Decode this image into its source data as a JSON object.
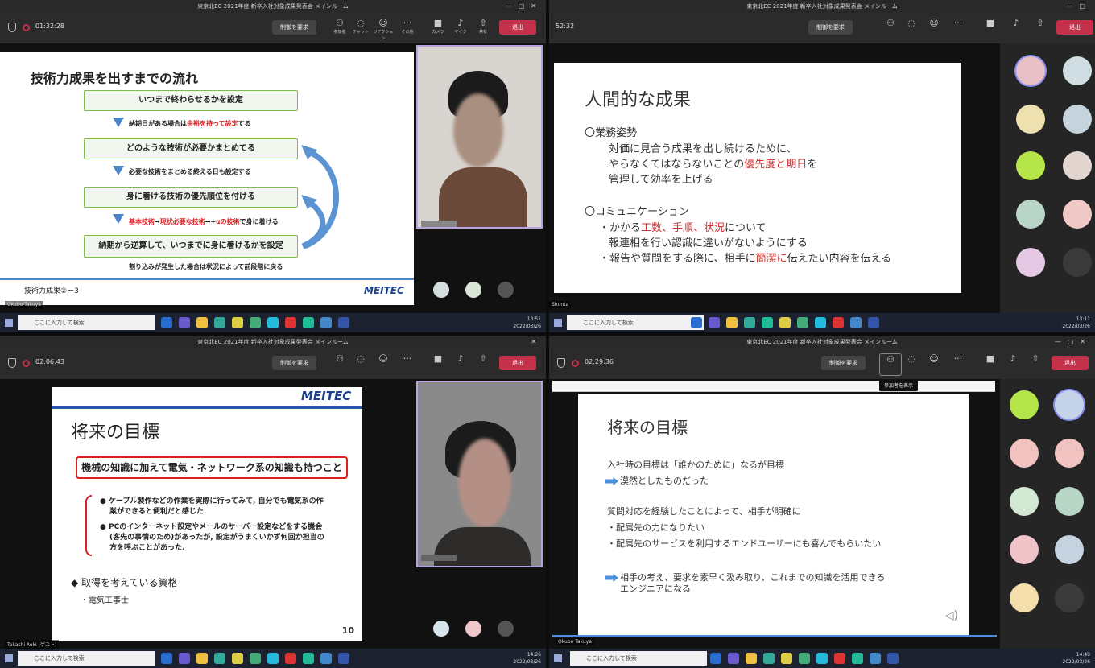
{
  "q1": {
    "title": "東京北EC 2021年度 新卒入社対象成果発表会 メインルーム",
    "timer": "01:32:28",
    "request": "制御を要求",
    "controls": [
      "参加者",
      "チャット",
      "リアクション",
      "その他",
      "カメラ",
      "マイク",
      "共有"
    ],
    "leave": "退出",
    "slide_title": "技術力成果を出すまでの流れ",
    "boxes": [
      "いつまで終わらせるかを設定",
      "どのような技術が必要かまとめてる",
      "身に着ける技術の優先順位を付ける",
      "納期から逆算して、いつまでに身に着けるかを設定"
    ],
    "n1a": "納期日がある場合は",
    "n1r": "余裕を持って設定",
    "n1b": "する",
    "n2": "必要な技術をまとめる終える日も設定する",
    "n3r1": "基本技術",
    "n3a": "→",
    "n3r2": "現状必要な技術",
    "n3b": "→+",
    "n3r3": "αの技術",
    "n3c": "で身に着ける",
    "interrupt": "割り込みが発生した場合は状況によって前段階に戻る",
    "footer": "技術力成果②ー3",
    "logo": "MEITEC",
    "logo_sub": "Engineering Firm at The Core",
    "presenter": "Okubo Takuya",
    "search": "ここに入力して検索",
    "time": "13:51",
    "date": "2022/03/26"
  },
  "q2": {
    "title": "東京北EC 2021年度 新卒入社対象成果発表会 メインルーム",
    "timer": "52:32",
    "request": "制御を要求",
    "leave": "退出",
    "slide_title": "人間的な成果",
    "h1": "〇業務姿勢",
    "l1": "対価に見合う成果を出し続けるために、",
    "l2a": "やらなくてはならないことの",
    "l2r": "優先度と期日",
    "l2b": "を",
    "l3": "管理して効率を上げる",
    "h2": "〇コミュニケーション",
    "l4a": "・かかる",
    "l4r": "工数、手順、状況",
    "l4b": "について",
    "l5": "報連相を行い認識に違いがないようにする",
    "l6a": "・報告や質問をする際に、相手に",
    "l6r": "簡潔に",
    "l6b": "伝えたい内容を伝える",
    "presenter": "Shunta",
    "search": "ここに入力して検索",
    "time": "13:11",
    "date": "2022/03/26"
  },
  "q3": {
    "title": "東京北EC 2021年度 新卒入社対象成果発表会 メインルーム",
    "timer": "02:06:43",
    "request": "制御を要求",
    "leave": "退出",
    "logo": "MEITEC",
    "logo_sub": "Engineering Firm at The Core",
    "slide_title": "将来の目標",
    "goal": "機械の知識に加えて電気・ネットワーク系の知識も持つこと",
    "b1": "ケーブル製作などの作業を実際に行ってみて, 自分でも電気系の作業ができると便利だと感じた.",
    "b2": "PCのインターネット設定やメールのサーバー設定などをする機会(客先の事情のため)があったが, 設定がうまくいかず何回か担当の方を呼ぶことがあった.",
    "qual": "◆ 取得を考えている資格",
    "qual1": "・電気工事士",
    "page": "10",
    "presenter": "Takashi Aoki (ゲスト)",
    "search": "ここに入力して検索",
    "time": "14:26",
    "date": "2022/03/26"
  },
  "q4": {
    "title": "東京北EC 2021年度 新卒入社対象成果発表会 メインルーム",
    "timer": "02:29:36",
    "request": "制御を要求",
    "leave": "退出",
    "tooltip": "参加者を表示",
    "slide_title": "将来の目標",
    "p1": "入社時の目標は「誰かのために」なるが目標",
    "p2": "漠然としたものだった",
    "p3": "質問対応を経験したことによって、相手が明確に",
    "p4": "・配属先の力になりたい",
    "p5": "・配属先のサービスを利用するエンドユーザーにも喜んでもらいたい",
    "p6": "相手の考え、要求を素早く汲み取り、これまでの知識を活用できる",
    "p7": "エンジニアになる",
    "presenter": "Okubo Takuya",
    "search": "ここに入力して検索",
    "time": "14:49",
    "date": "2022/03/26"
  }
}
